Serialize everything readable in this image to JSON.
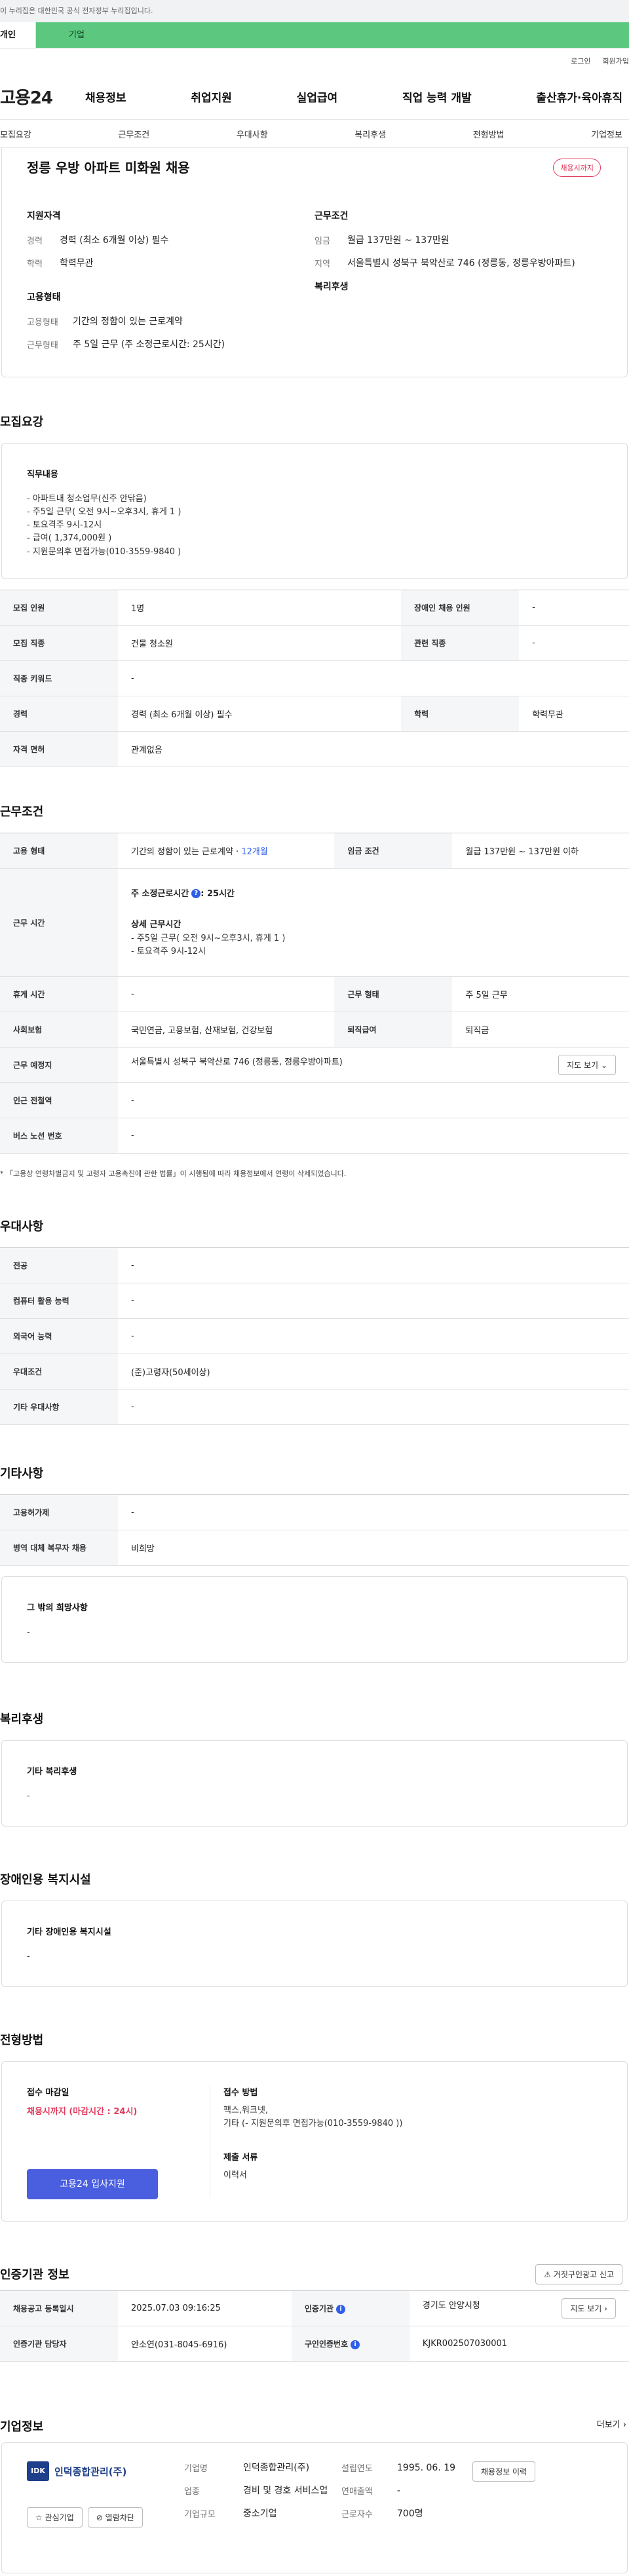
{
  "gov": {
    "notice": "이 누리집은 대한민국 공식 전자정부 누리집입니다."
  },
  "top_tabs": {
    "personal": "개인",
    "company": "기업"
  },
  "util": {
    "login": "로그인",
    "signup": "회원가입"
  },
  "gnb": {
    "logo": "고용24",
    "menu": [
      "채용정보",
      "취업지원",
      "실업급여",
      "직업 능력 개발",
      "출산휴가·육아휴직"
    ]
  },
  "subnav": [
    "모집요강",
    "근무조건",
    "우대사항",
    "복리후생",
    "전형방법",
    "기업정보"
  ],
  "header": {
    "title": "정릉 우방 아파트 미화원 채용",
    "badge": "채용시까지",
    "qual_title": "지원자격",
    "career_k": "경력",
    "career_v": "경력 (최소 6개월 이상) 필수",
    "edu_k": "학력",
    "edu_v": "학력무관",
    "emp_title": "고용형태",
    "emp_k1": "고용형태",
    "emp_v1": "기간의 정함이 있는 근로계약",
    "emp_k2": "근무형태",
    "emp_v2": "주 5일 근무 (주 소정근로시간: 25시간)",
    "cond_title": "근무조건",
    "wage_k": "임금",
    "wage_v": "월급 137만원 ~ 137만원",
    "region_k": "지역",
    "region_v": "서울특별시 성북구 북악산로 746 (정릉동, 정릉우방아파트)",
    "welfare_title": "복리후생"
  },
  "recruit": {
    "section": "모집요강",
    "duty_title": "직무내용",
    "duty_lines": [
      "- 아파트내 청소업무(신주 안닦음)",
      "- 주5일 근무( 오전 9시~오후3시, 휴게 1 )",
      "- 토요격주 9시-12시",
      "- 급여( 1,374,000원 )",
      "- 지원문의후 면접가능(010-3559-9840 )"
    ],
    "headcount_k": "모집 인원",
    "headcount_v": "1명",
    "disabled_k": "장애인 채용 인원",
    "disabled_v": "-",
    "job_k": "모집 직종",
    "job_v": "건물 청소원",
    "rel_k": "관련 직종",
    "rel_v": "-",
    "kw_k": "직종 키워드",
    "kw_v": "-",
    "career_k": "경력",
    "career_v": "경력 (최소 6개월 이상) 필수",
    "edu_k": "학력",
    "edu_v": "학력무관",
    "license_k": "자격 면허",
    "license_v": "관계없음"
  },
  "work": {
    "section": "근무조건",
    "type_k": "고용 형태",
    "type_v": "기간의 정함이 있는 근로계약 · ",
    "type_months": "12개월",
    "wage_k": "임금 조건",
    "wage_v": "월급 137만원 ~ 137만원 이하",
    "hours_k": "근무 시간",
    "hours_weekly": "주 소정근로시간",
    "hours_weekly_v": ": 25시간",
    "hours_detail_title": "상세 근무시간",
    "hours_lines": [
      "- 주5일 근무( 오전 9시~오후3시, 휴게 1 )",
      "- 토요격주 9시-12시"
    ],
    "break_k": "휴게 시간",
    "break_v": "-",
    "form_k": "근무 형태",
    "form_v": "주 5일 근무",
    "ins_k": "사회보험",
    "ins_v": "국민연금, 고용보험, 산재보험, 건강보험",
    "sev_k": "퇴직급여",
    "sev_v": "퇴직금",
    "place_k": "근무 예정지",
    "place_v": "서울특별시 성북구 북악산로 746 (정릉동, 정릉우방아파트)",
    "map_btn": "지도 보기",
    "subway_k": "인근 전철역",
    "subway_v": "-",
    "bus_k": "버스 노선 번호",
    "bus_v": "-",
    "note": "「고용상 연령차별금지 및 고령자 고용촉진에 관한 법률」이 시행됨에 따라 채용정보에서 연령이 삭제되었습니다."
  },
  "pref": {
    "section": "우대사항",
    "major_k": "전공",
    "major_v": "-",
    "pc_k": "컴퓨터 활용 능력",
    "pc_v": "-",
    "lang_k": "외국어 능력",
    "lang_v": "-",
    "cond_k": "우대조건",
    "cond_v": "(준)고령자(50세이상)",
    "etc_k": "기타 우대사항",
    "etc_v": "-"
  },
  "other": {
    "section": "기타사항",
    "hire_k": "고용허가제",
    "hire_v": "-",
    "mil_k": "병역 대체 복무자 채용",
    "mil_v": "비희망",
    "other_title": "그 밖의 희망사항",
    "other_v": "-"
  },
  "welfare": {
    "section": "복리후생",
    "title": "기타 복리후생",
    "value": "-"
  },
  "facility": {
    "section": "장애인용 복지시설",
    "title": "기타 장애인용 복지시설",
    "value": "-"
  },
  "selection": {
    "section": "전형방법",
    "deadline_title": "접수 마감일",
    "deadline_v": "채용시까지 (마감시간 : 24시)",
    "method_title": "접수 방법",
    "method_lines": [
      "팩스,워크넷,",
      "기타 (- 지원문의후 면접가능(010-3559-9840 ))"
    ],
    "docs_title": "제출 서류",
    "docs_v": "이력서",
    "apply_btn": "고용24 입사지원"
  },
  "agency": {
    "section": "인증기관 정보",
    "report_btn": "거짓구인광고 신고",
    "reg_k": "채용공고 등록일시",
    "reg_v": "2025.07.03 09:16:25",
    "org_k": "인증기관",
    "org_v": "경기도 안양시청",
    "map_btn": "지도 보기",
    "mgr_k": "인증기관 담당자",
    "mgr_v": "안소연(031-8045-6916)",
    "cert_k": "구인인증번호",
    "cert_v": "KJKR002507030001"
  },
  "company": {
    "section": "기업정보",
    "more": "더보기",
    "logo_text": "IDK",
    "name_logo": "인덕종합관리(주)",
    "interest_btn": "관심기업",
    "block_btn": "열람차단",
    "name_k": "기업명",
    "name_v": "인덕종합관리(주)",
    "biz_k": "업종",
    "biz_v": "경비 및 경호 서비스업",
    "size_k": "기업규모",
    "size_v": "중소기업",
    "est_k": "설립연도",
    "est_v": "1995. 06. 19",
    "sales_k": "연매출액",
    "sales_v": "-",
    "emp_k": "근로자수",
    "emp_v": "700명",
    "history_btn": "채용정보 이력"
  }
}
